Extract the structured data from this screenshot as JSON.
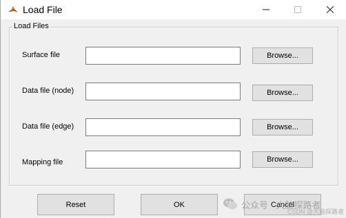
{
  "window": {
    "title": "Load File",
    "icon": "matlab-icon"
  },
  "group": {
    "title": "Load Files"
  },
  "rows": [
    {
      "label": "Surface file",
      "value": "",
      "browse_label": "Browse..."
    },
    {
      "label": "Data file (node)",
      "value": "",
      "browse_label": "Browse..."
    },
    {
      "label": "Data file (edge)",
      "value": "",
      "browse_label": "Browse..."
    },
    {
      "label": "Mapping file",
      "value": "",
      "browse_label": "Browse..."
    }
  ],
  "buttons": {
    "reset": "Reset",
    "ok": "OK",
    "cancel": "Cancel"
  },
  "watermark": {
    "main": "公众号 · 大脑探路者",
    "sub": "CSDN @大脑探路者"
  },
  "colors": {
    "window_bg": "#f0f0f0",
    "button_bg": "#e1e1e1",
    "button_border": "#adadad"
  }
}
